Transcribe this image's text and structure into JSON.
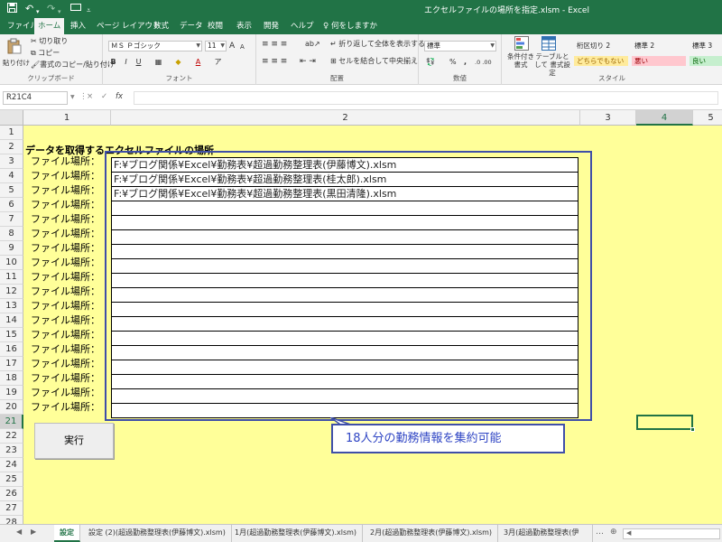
{
  "window": {
    "title": "エクセルファイルの場所を指定.xlsm  -  Excel",
    "quick_access": [
      "save-icon",
      "undo-icon",
      "redo-icon",
      "touch-mode-icon",
      "customize-icon"
    ]
  },
  "ribbon_tabs": [
    "ファイル",
    "ホーム",
    "挿入",
    "ページ レイアウト",
    "数式",
    "データ",
    "校閲",
    "表示",
    "開発",
    "ヘルプ"
  ],
  "active_tab": "ホーム",
  "tell_me": "何をしますか",
  "ribbon": {
    "clipboard": {
      "paste": "貼り付け",
      "cut": "切り取り",
      "copy": "コピー",
      "format_painter": "書式のコピー/貼り付け",
      "label": "クリップボード"
    },
    "font": {
      "name": "ＭＳ Ｐゴシック",
      "size": "11",
      "grow": "A",
      "shrink": "A",
      "bold": "B",
      "italic": "I",
      "underline": "U",
      "font_color": "A",
      "phonetic": "ア",
      "label": "フォント"
    },
    "alignment": {
      "wrap": "折り返して全体を表示する",
      "merge": "セルを結合して中央揃え",
      "label": "配置"
    },
    "number": {
      "format": "標準",
      "percent": "%",
      "comma": ",",
      "label": "数値"
    },
    "styles": {
      "conditional": "条件付き 書式",
      "table": "テーブルとして 書式設定",
      "cells": [
        "桁区切り 2",
        "標準 2",
        "標準 3",
        "どちらでもない",
        "悪い",
        "良い"
      ],
      "label": "スタイル"
    }
  },
  "formula_bar": {
    "name_box": "R21C4",
    "cancel": "×",
    "enter": "✓",
    "function": "fx",
    "content": ""
  },
  "grid": {
    "columns": [
      "1",
      "2",
      "3",
      "4",
      "5"
    ],
    "selected_column": "4",
    "rows": [
      "1",
      "2",
      "3",
      "4",
      "5",
      "6",
      "7",
      "8",
      "9",
      "10",
      "11",
      "12",
      "13",
      "14",
      "15",
      "16",
      "17",
      "18",
      "19",
      "20",
      "21",
      "22",
      "23",
      "24",
      "25",
      "26",
      "27",
      "28"
    ],
    "selected_row": "21"
  },
  "sheet": {
    "heading": "データを取得するエクセルファイルの場所",
    "label": "ファイル場所：",
    "paths": [
      "F:¥ブログ関係¥Excel¥勤務表¥超過勤務整理表(伊藤博文).xlsm",
      "F:¥ブログ関係¥Excel¥勤務表¥超過勤務整理表(桂太郎).xlsm",
      "F:¥ブログ関係¥Excel¥勤務表¥超過勤務整理表(黒田清隆).xlsm",
      "",
      "",
      "",
      "",
      "",
      "",
      "",
      "",
      "",
      "",
      "",
      "",
      "",
      "",
      ""
    ],
    "run_button": "実行",
    "callout": "18人分の勤務情報を集約可能"
  },
  "sheet_tabs": {
    "tabs": [
      "設定",
      "設定 (2)(超過勤務整理表(伊藤博文).xlsm)",
      "1月(超過勤務整理表(伊藤博文).xlsm)",
      "2月(超過勤務整理表(伊藤博文).xlsm)",
      "3月(超過勤務整理表(伊"
    ],
    "active": "設定"
  },
  "colors": {
    "excel_green": "#217346",
    "sheet_fill": "#ffff99",
    "frame_blue": "#3f4fa8",
    "callout_text": "#2f45c4"
  }
}
